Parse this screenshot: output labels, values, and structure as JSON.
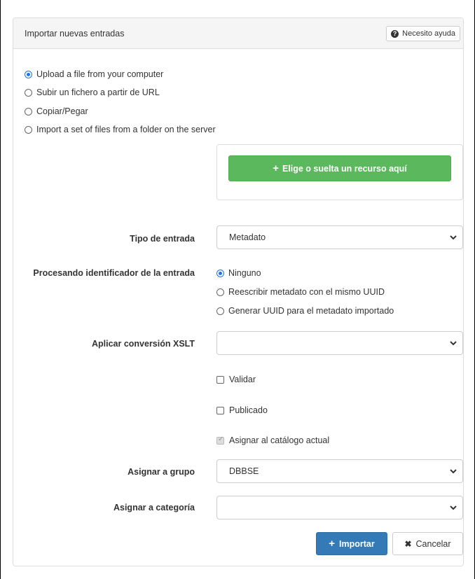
{
  "panel": {
    "title": "Importar nuevas entradas",
    "help_label": "Necesito ayuda",
    "help_icon": "question-circle-icon"
  },
  "import_mode": {
    "options": [
      {
        "label": "Upload a file from your computer",
        "checked": true
      },
      {
        "label": "Subir un fichero a partir de URL",
        "checked": false
      },
      {
        "label": "Copiar/Pegar",
        "checked": false
      },
      {
        "label": "Import a set of files from a folder on the server",
        "checked": false
      }
    ]
  },
  "dropzone": {
    "button_label": "Elige o suelta un recurso aquí",
    "button_icon": "plus-icon"
  },
  "record_type": {
    "label": "Tipo de entrada",
    "value": "Metadato"
  },
  "uuid_processing": {
    "label": "Procesando identificador de la entrada",
    "options": [
      {
        "label": "Ninguno",
        "checked": true
      },
      {
        "label": "Reescribir metadato con el mismo UUID",
        "checked": false
      },
      {
        "label": "Generar UUID para el metadato importado",
        "checked": false
      }
    ]
  },
  "xslt": {
    "label": "Aplicar conversión XSLT",
    "value": ""
  },
  "checkboxes": {
    "validate": {
      "label": "Validar",
      "checked": false
    },
    "published": {
      "label": "Publicado",
      "checked": false
    },
    "assign_catalog": {
      "label": "Asignar al catálogo actual",
      "checked": true,
      "disabled": true
    }
  },
  "group": {
    "label": "Asignar a grupo",
    "value": "DBBSE"
  },
  "category": {
    "label": "Asignar a categoría",
    "value": ""
  },
  "actions": {
    "import_label": "Importar",
    "cancel_label": "Cancelar"
  },
  "colors": {
    "primary": "#337ab7",
    "success": "#5cb85c",
    "radio_accent": "#1a73e8"
  }
}
